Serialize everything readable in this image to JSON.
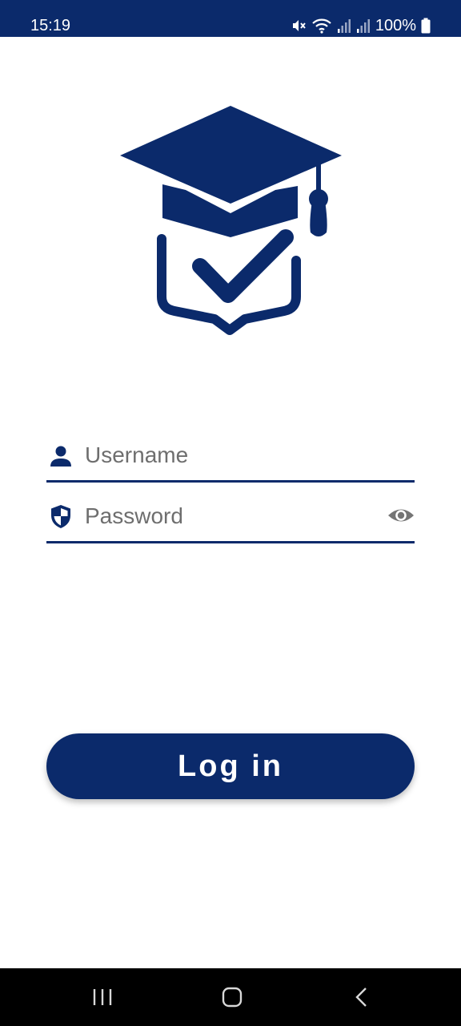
{
  "status_bar": {
    "time": "15:19",
    "battery": "100%",
    "icons": [
      "mute-icon",
      "wifi-icon",
      "signal-icon",
      "signal-icon",
      "battery-icon"
    ]
  },
  "logo": {
    "icon": "graduation-cap-check-icon"
  },
  "form": {
    "username_placeholder": "Username",
    "password_placeholder": "Password",
    "username_icon": "person-icon",
    "password_icon": "shield-icon",
    "toggle_icon": "eye-icon"
  },
  "login_button": {
    "label": "Log in"
  },
  "nav_bar": {
    "icons": [
      "recents-icon",
      "home-icon",
      "back-icon"
    ]
  },
  "colors": {
    "primary": "#0b2a6b",
    "placeholder": "#6e6e6e",
    "eye": "#757575"
  }
}
